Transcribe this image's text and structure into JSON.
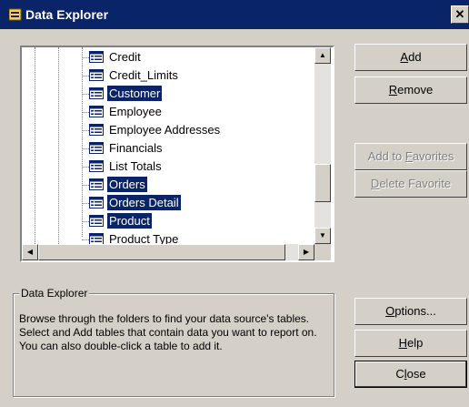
{
  "window": {
    "title": "Data Explorer",
    "close_glyph": "✕"
  },
  "tree": {
    "items": [
      {
        "label": "Credit",
        "selected": false
      },
      {
        "label": "Credit_Limits",
        "selected": false
      },
      {
        "label": "Customer",
        "selected": true
      },
      {
        "label": "Employee",
        "selected": false
      },
      {
        "label": "Employee Addresses",
        "selected": false
      },
      {
        "label": "Financials",
        "selected": false
      },
      {
        "label": "List Totals",
        "selected": false
      },
      {
        "label": "Orders",
        "selected": true
      },
      {
        "label": "Orders Detail",
        "selected": true
      },
      {
        "label": "Product",
        "selected": true
      },
      {
        "label": "Product Type",
        "selected": false
      }
    ]
  },
  "buttons": {
    "add": {
      "pre": "",
      "key": "A",
      "post": "dd"
    },
    "remove": {
      "pre": "",
      "key": "R",
      "post": "emove"
    },
    "add_favorites": {
      "pre": "Add to ",
      "key": "F",
      "post": "avorites"
    },
    "delete_favorite": {
      "pre": "",
      "key": "D",
      "post": "elete Favorite"
    },
    "options": {
      "pre": "",
      "key": "O",
      "post": "ptions..."
    },
    "help": {
      "pre": "",
      "key": "H",
      "post": "elp"
    },
    "close": {
      "pre": "C",
      "key": "l",
      "post": "ose"
    }
  },
  "group": {
    "legend": "Data Explorer",
    "description": "Browse through the folders to find your data source's tables.  Select and Add tables that contain data you want to report on.  You can also double-click a table to add it."
  },
  "scrollbar": {
    "up": "▲",
    "down": "▼",
    "left": "◀",
    "right": "▶"
  }
}
